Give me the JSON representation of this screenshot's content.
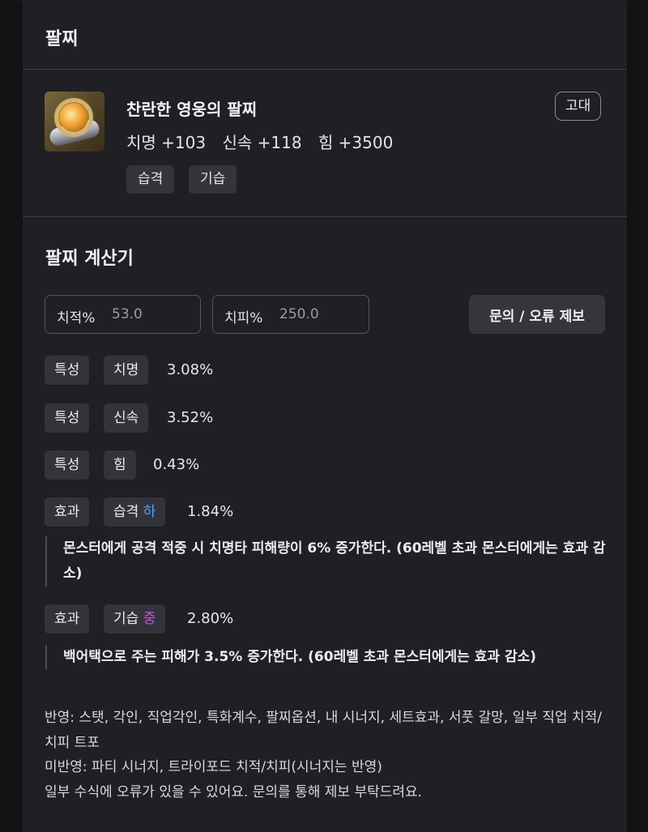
{
  "header": {
    "title": "팔찌"
  },
  "item": {
    "name": "찬란한 영웅의 팔찌",
    "grade": "고대",
    "stats": [
      "치명 +103",
      "신속 +118",
      "힘 +3500"
    ],
    "tags": [
      "습격",
      "기습"
    ]
  },
  "calculator": {
    "title": "팔찌 계산기",
    "crit_rate_label": "치적%",
    "crit_rate_value": "53.0",
    "crit_damage_label": "치피%",
    "crit_damage_value": "250.0",
    "report_button": "문의 / 오류 제보",
    "rows": [
      {
        "type": "특성",
        "name": "치명",
        "level": "",
        "pct": "3.08%"
      },
      {
        "type": "특성",
        "name": "신속",
        "level": "",
        "pct": "3.52%"
      },
      {
        "type": "특성",
        "name": "힘",
        "level": "",
        "pct": "0.43%"
      },
      {
        "type": "효과",
        "name": "습격",
        "level": "하",
        "pct": "1.84%",
        "description": "몬스터에게 공격 적중 시 치명타 피해량이 6% 증가한다. (60레벨 초과 몬스터에게는 효과 감소)"
      },
      {
        "type": "효과",
        "name": "기습",
        "level": "중",
        "pct": "2.80%",
        "description": "백어택으로 주는 피해가 3.5% 증가한다. (60레벨 초과 몬스터에게는 효과 감소)"
      }
    ],
    "level_colors": {
      "하": "#4aa8ff",
      "중": "#d24ee8"
    }
  },
  "notes": {
    "reflected": "반영: 스탯, 각인, 직업각인, 특화계수, 팔찌옵션, 내 시너지, 세트효과, 서풋 갈망, 일부 직업 치적/치피 트포",
    "not_reflected": "미반영: 파티 시너지, 트라이포드 치적/치피(시너지는 반영)",
    "disclaimer": "일부 수식에 오류가 있을 수 있어요. 문의를 통해 제보 부탁드려요."
  }
}
